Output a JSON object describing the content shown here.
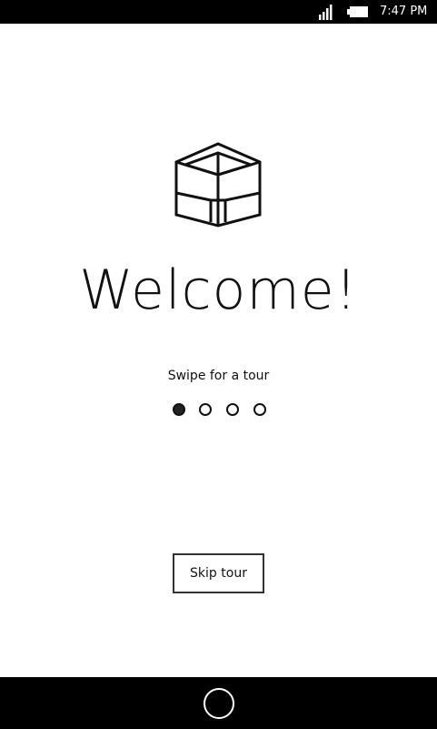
{
  "status_bar": {
    "time": "7:47 PM",
    "signal_icon": "cellular-signal-icon",
    "battery_icon": "battery-icon"
  },
  "logo_icon": "cube-icon",
  "welcome": {
    "title": "Welcome!",
    "subtitle": "Swipe for a tour"
  },
  "pager": {
    "page_count": 4,
    "active_index": 0
  },
  "skip_button": {
    "label": "Skip tour"
  },
  "nav_bar": {
    "home_icon": "home-button-icon"
  },
  "colors": {
    "background": "#ffffff",
    "bars": "#000000",
    "text": "#111111"
  }
}
